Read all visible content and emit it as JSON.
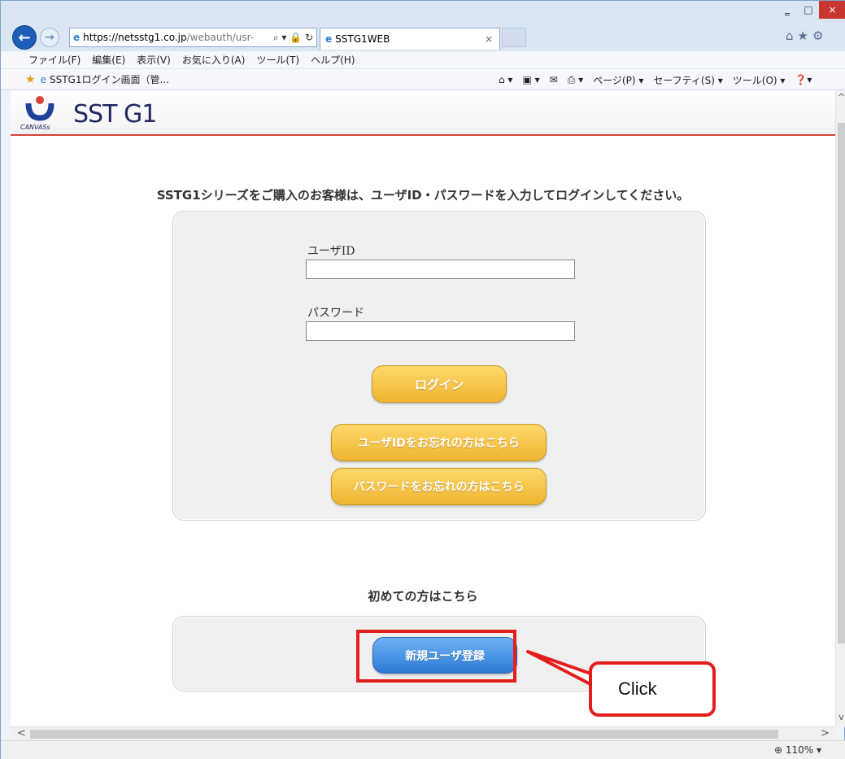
{
  "browser": {
    "url_host": "https://netsstg1.co.jp",
    "url_path": "/webauth/usr-",
    "tab_title": "SSTG1WEB",
    "tab_close": "×",
    "win_min": "‗",
    "win_max": "□",
    "win_close": "×",
    "menu": [
      "ファイル(F)",
      "編集(E)",
      "表示(V)",
      "お気に入り(A)",
      "ツール(T)",
      "ヘルプ(H)"
    ],
    "favorite": "SSTG1ログイン画面（管...",
    "commands": [
      "ページ(P) ▾",
      "セーフティ(S) ▾",
      "ツール(O) ▾"
    ],
    "zoom": "110%"
  },
  "page": {
    "brand": "SST G1",
    "logo_sub": "CANVASs",
    "intro": "SSTG1シリーズをご購入のお客様は、ユーザID・パスワードを入力してログインしてください。",
    "userid_label": "ユーザID",
    "password_label": "パスワード",
    "login_button": "ログイン",
    "forgot_id_button": "ユーザIDをお忘れの方はこちら",
    "forgot_pw_button": "パスワードをお忘れの方はこちら",
    "first_time": "初めての方はこちら",
    "register_button": "新規ユーザ登録"
  },
  "annotation": {
    "callout": "Click",
    "color": "#e41d1d"
  }
}
